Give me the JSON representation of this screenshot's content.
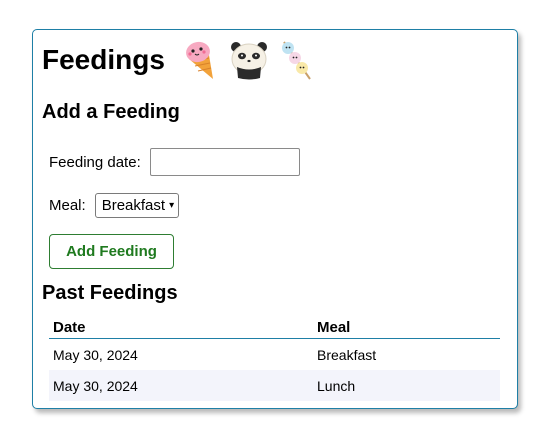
{
  "header": {
    "title": "Feedings",
    "decorations": [
      "ice-cream-icon",
      "panda-rice-ball-icon",
      "dango-skewer-icon"
    ]
  },
  "add_section": {
    "title": "Add a Feeding",
    "date_label": "Feeding date:",
    "date_value": "",
    "meal_label": "Meal:",
    "meal_selected": "Breakfast",
    "submit_label": "Add Feeding"
  },
  "past_section": {
    "title": "Past Feedings",
    "columns": [
      "Date",
      "Meal"
    ],
    "rows": [
      {
        "date": "May 30, 2024",
        "meal": "Breakfast"
      },
      {
        "date": "May 30, 2024",
        "meal": "Lunch"
      }
    ]
  },
  "colors": {
    "accent_border": "#1e7fa6",
    "button_text": "#1f7a1f",
    "stripe": "#f3f4fb"
  }
}
